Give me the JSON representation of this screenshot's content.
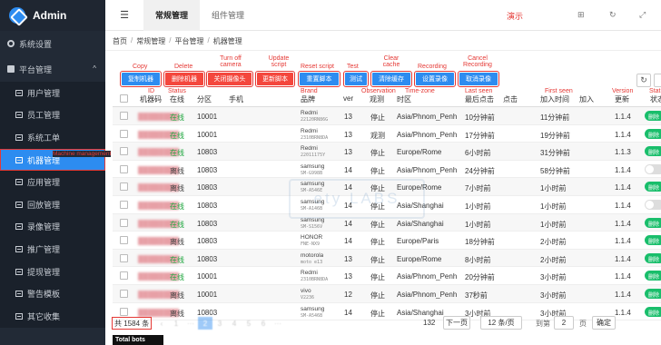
{
  "app": {
    "title": "Admin"
  },
  "sidebar": {
    "top_item": "系统设置",
    "group_label": "平台管理",
    "items": [
      {
        "label": "用户管理"
      },
      {
        "label": "员工管理"
      },
      {
        "label": "系统工单"
      },
      {
        "label": "机器管理",
        "active": true
      },
      {
        "label": "应用管理"
      },
      {
        "label": "回放管理"
      },
      {
        "label": "录像管理"
      },
      {
        "label": "推广管理"
      },
      {
        "label": "提现管理"
      },
      {
        "label": "警告模板"
      },
      {
        "label": "其它收集"
      }
    ],
    "annotation": "Machine management"
  },
  "topbar": {
    "tabs": [
      "常规管理",
      "组件管理"
    ],
    "demo_label": "演示"
  },
  "breadcrumb": [
    "首页",
    "常规管理",
    "平台管理",
    "机器管理"
  ],
  "toolbar": {
    "buttons": [
      {
        "label": "复制机器",
        "annotation": "Copy"
      },
      {
        "label": "删除机器",
        "annotation": "Delete"
      },
      {
        "label": "关闭摄像头",
        "annotation": "Turn off camera"
      },
      {
        "label": "更新脚本",
        "annotation": "Update script"
      },
      {
        "label": "重置脚本",
        "annotation": "Reset script"
      },
      {
        "label": "测试",
        "annotation": "Test"
      },
      {
        "label": "清除缓存",
        "annotation": "Clear cache"
      },
      {
        "label": "设置录像",
        "annotation": "Recording"
      },
      {
        "label": "取消录像",
        "annotation": "Cancel Recording"
      }
    ]
  },
  "column_annotations": {
    "id": "ID",
    "status": "Status",
    "brand": "Brand",
    "observation": "Observation",
    "timezone": "Time-zone",
    "last_seen": "Last seen",
    "first_seen": "First seen",
    "version": "Version",
    "stat": "Stat"
  },
  "table": {
    "headers": [
      "机器码",
      "在线",
      "分区",
      "手机",
      "品牌",
      "ver",
      "观测",
      "时区",
      "最后点击",
      "点击",
      "加入时间",
      "加入",
      "更新",
      "状态"
    ],
    "rows": [
      {
        "status": "在线",
        "zone": "10001",
        "brand": "Redmi",
        "model": "22120RN86G",
        "ver": "13",
        "obs": "停止",
        "tz": "Asia/Phnom_Penh",
        "last": "10分钟前",
        "join": "11分钟前",
        "update": "1.1.4",
        "on": true
      },
      {
        "status": "在线",
        "zone": "10001",
        "brand": "Redmi",
        "model": "2310BRN8DA",
        "ver": "13",
        "obs": "观测",
        "tz": "Asia/Phnom_Penh",
        "last": "17分钟前",
        "join": "19分钟前",
        "update": "1.1.4",
        "on": true
      },
      {
        "status": "在线",
        "zone": "10803",
        "brand": "Redmi",
        "model": "22011175Y",
        "ver": "13",
        "obs": "停止",
        "tz": "Europe/Rome",
        "last": "6小时前",
        "join": "31分钟前",
        "update": "1.1.3",
        "on": true
      },
      {
        "status": "离线",
        "zone": "10803",
        "brand": "samsung",
        "model": "SM-G998B",
        "ver": "14",
        "obs": "停止",
        "tz": "Asia/Phnom_Penh",
        "last": "24分钟前",
        "join": "58分钟前",
        "update": "1.1.4",
        "on": false
      },
      {
        "status": "离线",
        "zone": "10803",
        "brand": "samsung",
        "model": "SM-A546E",
        "ver": "14",
        "obs": "停止",
        "tz": "Europe/Rome",
        "last": "7小时前",
        "join": "1小时前",
        "update": "1.1.4",
        "on": true
      },
      {
        "status": "在线",
        "zone": "10803",
        "brand": "samsung",
        "model": "SM-A146B",
        "ver": "14",
        "obs": "停止",
        "tz": "Asia/Shanghai",
        "last": "1小时前",
        "join": "1小时前",
        "update": "1.1.4",
        "on": false
      },
      {
        "status": "在线",
        "zone": "10803",
        "brand": "samsung",
        "model": "SM-S156V",
        "ver": "14",
        "obs": "停止",
        "tz": "Asia/Shanghai",
        "last": "1小时前",
        "join": "1小时前",
        "update": "1.1.4",
        "on": true
      },
      {
        "status": "离线",
        "zone": "10803",
        "brand": "HONOR",
        "model": "FNE-NX9",
        "ver": "14",
        "obs": "停止",
        "tz": "Europe/Paris",
        "last": "18分钟前",
        "join": "2小时前",
        "update": "1.1.4",
        "on": true
      },
      {
        "status": "在线",
        "zone": "10803",
        "brand": "motorola",
        "model": "moto e13",
        "ver": "13",
        "obs": "停止",
        "tz": "Europe/Rome",
        "last": "8小时前",
        "join": "2小时前",
        "update": "1.1.4",
        "on": true
      },
      {
        "status": "在线",
        "zone": "10001",
        "brand": "Redmi",
        "model": "2310BRN8DA",
        "ver": "13",
        "obs": "停止",
        "tz": "Asia/Phnom_Penh",
        "last": "20分钟前",
        "join": "3小时前",
        "update": "1.1.4",
        "on": true
      },
      {
        "status": "离线",
        "zone": "10001",
        "brand": "vivo",
        "model": "V2236",
        "ver": "12",
        "obs": "停止",
        "tz": "Asia/Phnom_Penh",
        "last": "37秒前",
        "join": "3小时前",
        "update": "1.1.4",
        "on": true
      },
      {
        "status": "离线",
        "zone": "10803",
        "brand": "samsung",
        "model": "SM-A546B",
        "ver": "14",
        "obs": "停止",
        "tz": "Asia/Shanghai",
        "last": "3小时前",
        "join": "3小时前",
        "update": "1.1.4",
        "on": true
      }
    ]
  },
  "pagination": {
    "total": "共 1584 条",
    "last_page": "132",
    "next": "下一页",
    "page_size": "12 条/页",
    "goto_prefix": "到第",
    "goto_value": "2",
    "goto_suffix": "页",
    "confirm": "确定"
  },
  "footer_thumb": "Total bots",
  "watermark_text": "ety  LABS",
  "colors": {
    "sidebar_bg": "#222a36",
    "accent": "#2d8cf0",
    "danger": "#f4473d",
    "online": "#22a842",
    "annotation": "#e53935"
  }
}
